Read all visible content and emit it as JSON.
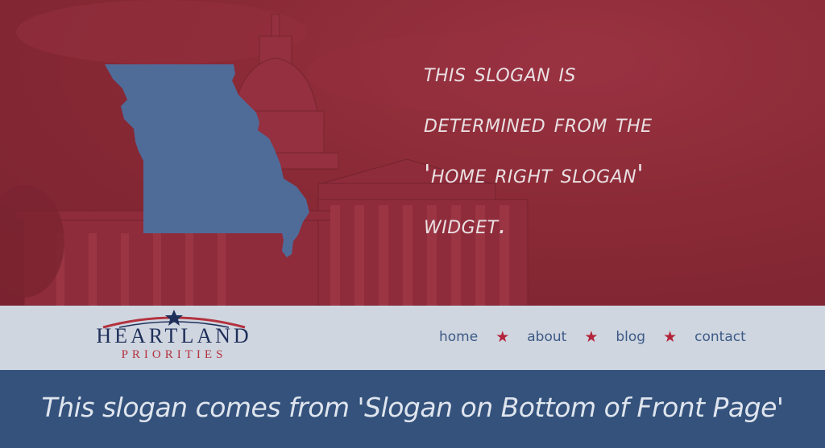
{
  "hero": {
    "slogan_lines": [
      "This slogan is",
      "determined from the",
      "'Home Right Slogan'",
      "widget."
    ],
    "state_shape_icon": "missouri-map-icon",
    "background_image": "capitol-building-photo",
    "overlay_color": "#8a2a36",
    "state_color": "#4f6c99"
  },
  "logo": {
    "word": "HEARTLAND",
    "subtitle": "PRIORITIES",
    "star_icon": "star-icon"
  },
  "nav": {
    "items": [
      "home",
      "about",
      "blog",
      "contact"
    ],
    "separator_icon": "star-icon",
    "separator_glyph": "★"
  },
  "footer": {
    "slogan": "This slogan comes from 'Slogan on Bottom of Front Page'"
  },
  "colors": {
    "nav_bg": "#cfd6e0",
    "nav_text": "#3d5a86",
    "star": "#b3243a",
    "bottom_bg": "#34527c",
    "logo_navy": "#1f2f5a",
    "logo_red": "#b3323e"
  }
}
